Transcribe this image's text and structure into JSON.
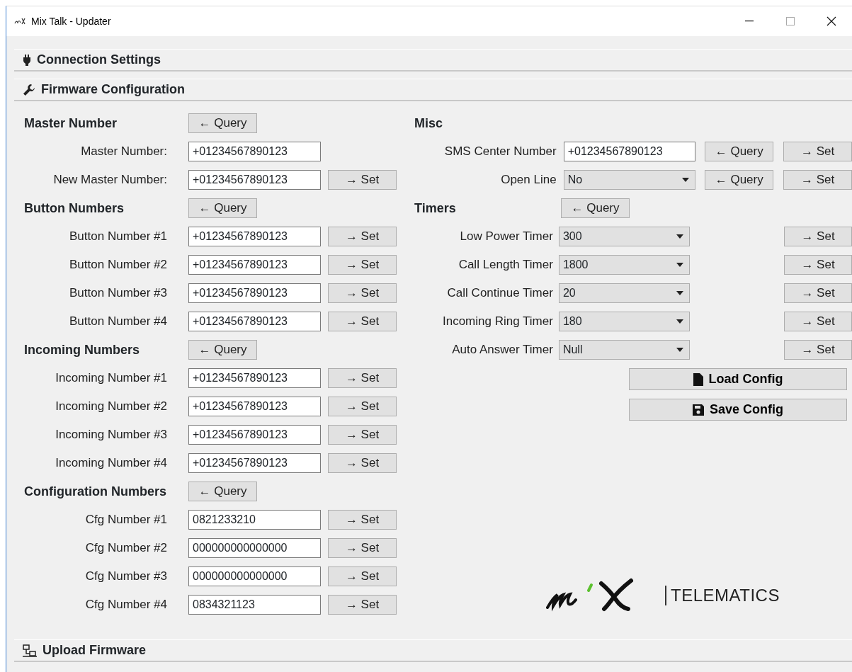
{
  "window": {
    "title": "Mix Talk - Updater"
  },
  "sections": [
    {
      "title": "Connection Settings",
      "kind": "plug"
    },
    {
      "title": "Firmware Configuration",
      "kind": "wrench"
    },
    {
      "title": "Upload Firmware",
      "kind": "network"
    }
  ],
  "left_groups": [
    {
      "heading": "Master Number",
      "query": "← Query",
      "rows": [
        {
          "label": "Master Number:",
          "value": "+01234567890123"
        },
        {
          "label": "New Master Number:",
          "value": "+01234567890123",
          "set": "→ Set"
        }
      ]
    },
    {
      "heading": "Button Numbers",
      "query": "← Query",
      "rows": [
        {
          "label": "Button Number #1",
          "value": "+01234567890123",
          "set": "→ Set"
        },
        {
          "label": "Button Number #2",
          "value": "+01234567890123",
          "set": "→ Set"
        },
        {
          "label": "Button Number #3",
          "value": "+01234567890123",
          "set": "→ Set"
        },
        {
          "label": "Button Number #4",
          "value": "+01234567890123",
          "set": "→ Set"
        }
      ]
    },
    {
      "heading": "Incoming Numbers",
      "query": "← Query",
      "rows": [
        {
          "label": "Incoming Number #1",
          "value": "+01234567890123",
          "set": "→ Set"
        },
        {
          "label": "Incoming Number #2",
          "value": "+01234567890123",
          "set": "→ Set"
        },
        {
          "label": "Incoming Number #3",
          "value": "+01234567890123",
          "set": "→ Set"
        },
        {
          "label": "Incoming Number #4",
          "value": "+01234567890123",
          "set": "→ Set"
        }
      ]
    },
    {
      "heading": "Configuration Numbers",
      "query": "← Query",
      "rows": [
        {
          "label": "Cfg Number #1",
          "value": "0821233210",
          "set": "→ Set"
        },
        {
          "label": "Cfg Number #2",
          "value": "000000000000000",
          "set": "→ Set"
        },
        {
          "label": "Cfg Number #3",
          "value": "000000000000000",
          "set": "→ Set"
        },
        {
          "label": "Cfg Number #4",
          "value": "0834321123",
          "set": "→ Set"
        }
      ]
    }
  ],
  "misc": {
    "heading": "Misc",
    "rows": [
      {
        "kind": "input",
        "label": "SMS Center Number",
        "value": "+01234567890123",
        "query": "← Query",
        "set": "→ Set"
      },
      {
        "kind": "select",
        "label": "Open Line",
        "value": "No",
        "query": "← Query",
        "set": "→ Set"
      }
    ]
  },
  "timers": {
    "heading": "Timers",
    "query": "← Query",
    "rows": [
      {
        "label": "Low Power Timer",
        "value": "300",
        "set": "→ Set"
      },
      {
        "label": "Call Length Timer",
        "value": "1800",
        "set": "→ Set"
      },
      {
        "label": "Call Continue Timer",
        "value": "20",
        "set": "→ Set"
      },
      {
        "label": "Incoming Ring Timer",
        "value": "180",
        "set": "→ Set"
      },
      {
        "label": "Auto Answer Timer",
        "value": "Null",
        "set": "→ Set"
      }
    ]
  },
  "actions": [
    {
      "label": "Load Config",
      "kind": "file"
    },
    {
      "label": "Save Config",
      "kind": "save"
    }
  ],
  "logo": {
    "text": "TELEMATICS"
  }
}
